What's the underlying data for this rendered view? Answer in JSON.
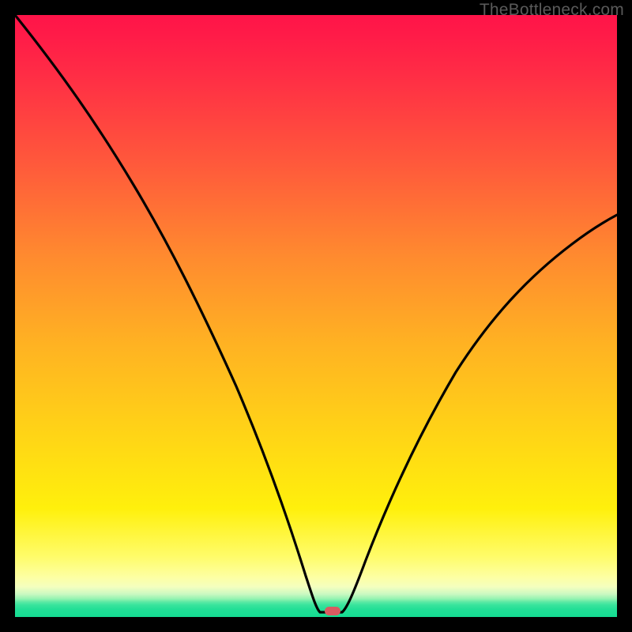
{
  "attribution": "TheBottleneck.com",
  "colors": {
    "frame": "#000000",
    "top": "#ff1449",
    "mid": "#ffd516",
    "bottom": "#14dc92",
    "curve_stroke": "#000000",
    "marker": "#d95b61"
  },
  "chart_data": {
    "type": "line",
    "title": "",
    "xlabel": "",
    "ylabel": "",
    "xlim": [
      0,
      100
    ],
    "ylim": [
      0,
      100
    ],
    "x": [
      0,
      5,
      10,
      15,
      20,
      25,
      30,
      35,
      40,
      45,
      48,
      50,
      52,
      54,
      55,
      58,
      60,
      65,
      70,
      75,
      80,
      85,
      90,
      95,
      100
    ],
    "values": [
      100,
      91,
      82,
      73,
      64,
      56,
      47,
      38,
      28,
      15,
      6,
      1,
      0,
      0,
      1,
      6,
      11,
      22,
      32,
      41,
      48,
      54.5,
      60,
      65,
      69
    ],
    "notes": "V-shaped bottleneck curve; minimum (optimal match) near x≈52–54% where value≈0; left branch steeper than right; flat segment at bottom between x≈50 and x≈54.",
    "marker": {
      "x": 53.5,
      "y": 0,
      "meaning": "optimal / current configuration indicator"
    }
  }
}
